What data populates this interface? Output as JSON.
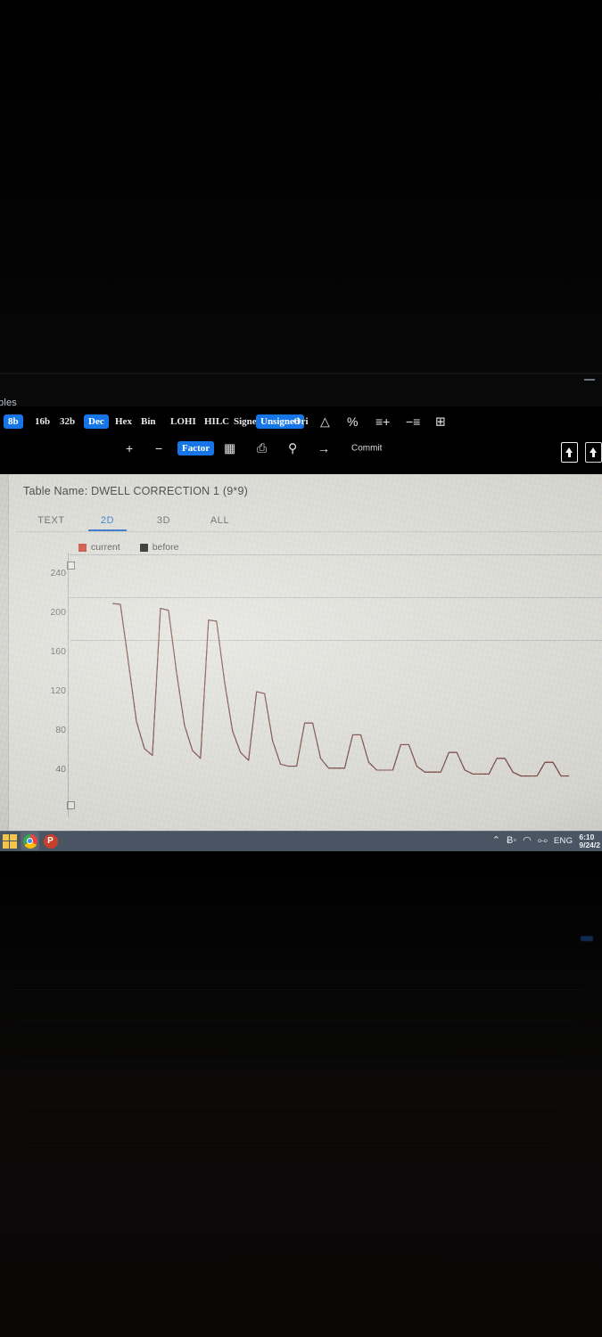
{
  "browser": {
    "tab_title": "bles",
    "minimize_label": "—",
    "translate_icon": "translate-icon",
    "bookmark_icon": "star-icon"
  },
  "toolbar": {
    "row1": [
      {
        "label": "8b",
        "active": true,
        "name": "bitwidth-8b"
      },
      {
        "label": "16b",
        "active": false,
        "name": "bitwidth-16b"
      },
      {
        "label": "32b",
        "active": false,
        "name": "bitwidth-32b"
      },
      {
        "label": "Dec",
        "active": true,
        "name": "format-dec"
      },
      {
        "label": "Hex",
        "active": false,
        "name": "format-hex"
      },
      {
        "label": "Bin",
        "active": false,
        "name": "format-bin"
      },
      {
        "label": "LOHI",
        "active": false,
        "name": "byteorder-lohi"
      },
      {
        "label": "HILC",
        "active": false,
        "name": "byteorder-hilc"
      },
      {
        "label": "Signed",
        "active": false,
        "name": "sign-signed"
      },
      {
        "label": "Unsigned",
        "active": true,
        "name": "sign-unsigned"
      },
      {
        "label": "Ori",
        "active": false,
        "name": "original-values"
      },
      {
        "label": "△",
        "active": false,
        "name": "delta-icon"
      },
      {
        "label": "%",
        "active": false,
        "name": "percent-icon"
      },
      {
        "label": "≡+",
        "active": false,
        "name": "add-rows-icon"
      },
      {
        "label": "−≡",
        "active": false,
        "name": "remove-rows-icon"
      },
      {
        "label": "⊞",
        "active": false,
        "name": "split-view-icon"
      }
    ],
    "row2": [
      {
        "label": "+",
        "active": false,
        "name": "increment-button"
      },
      {
        "label": "−",
        "active": false,
        "name": "decrement-button"
      },
      {
        "label": "Factor",
        "active": true,
        "name": "factor-button"
      },
      {
        "label": "▦",
        "active": false,
        "name": "grid-icon"
      },
      {
        "label": "⎙",
        "active": false,
        "name": "paste-table-icon"
      },
      {
        "label": "⚲",
        "active": false,
        "name": "search-icon"
      },
      {
        "label": "→",
        "active": false,
        "name": "go-to-icon"
      },
      {
        "label": "Commit",
        "active": false,
        "name": "commit-button"
      }
    ],
    "right_icons": [
      "upload-file-icon",
      "download-file-icon"
    ]
  },
  "app": {
    "table_name_label": "Table Name:",
    "table_name_value": "DWELL CORRECTION 1 (9*9)",
    "tabs": [
      {
        "label": "TEXT",
        "active": false
      },
      {
        "label": "2D",
        "active": true
      },
      {
        "label": "3D",
        "active": false
      },
      {
        "label": "ALL",
        "active": false
      }
    ]
  },
  "chart_data": {
    "type": "line",
    "title": "DWELL CORRECTION 1 (9*9)",
    "xlabel": "",
    "ylabel": "",
    "ylim": [
      0,
      260
    ],
    "yticks": [
      240,
      200,
      160,
      120,
      80,
      40
    ],
    "grid": true,
    "legend_position": "top-left",
    "legend": [
      {
        "name": "current",
        "color": "#c0392b"
      },
      {
        "name": "before",
        "color": "#111111"
      }
    ],
    "series": [
      {
        "name": "current",
        "color": "#c0392b",
        "values": [
          210,
          209,
          150,
          90,
          62,
          55,
          205,
          203,
          140,
          86,
          60,
          52,
          193,
          192,
          130,
          80,
          58,
          50,
          120,
          118,
          70,
          46,
          44,
          44,
          88,
          88,
          52,
          42,
          42,
          42,
          76,
          76,
          48,
          40,
          40,
          40,
          66,
          66,
          44,
          38,
          38,
          38,
          58,
          58,
          40,
          36,
          36,
          36,
          52,
          52,
          38,
          34,
          34,
          34,
          48,
          48,
          34,
          34
        ]
      },
      {
        "name": "before",
        "color": "#111111",
        "values": [
          210,
          209,
          150,
          90,
          62,
          55,
          205,
          203,
          140,
          86,
          60,
          52,
          193,
          192,
          130,
          80,
          58,
          50,
          120,
          118,
          70,
          46,
          44,
          44,
          88,
          88,
          52,
          42,
          42,
          42,
          76,
          76,
          48,
          40,
          40,
          40,
          66,
          66,
          44,
          38,
          38,
          38,
          58,
          58,
          40,
          36,
          36,
          36,
          52,
          52,
          38,
          34,
          34,
          34,
          48,
          48,
          34,
          34
        ]
      }
    ]
  },
  "taskbar": {
    "apps": [
      {
        "name": "start-button",
        "label": "⊞"
      },
      {
        "name": "chrome-icon",
        "label": ""
      },
      {
        "name": "powerpoint-icon",
        "label": "P"
      }
    ],
    "tray": {
      "overflow_icon": "⌃",
      "bluetooth_icon": "Ƀ◦",
      "wifi_icon": "◠",
      "volume_icon": "⧟",
      "language": "ENG",
      "time": "6:10",
      "date": "9/24/2"
    }
  }
}
